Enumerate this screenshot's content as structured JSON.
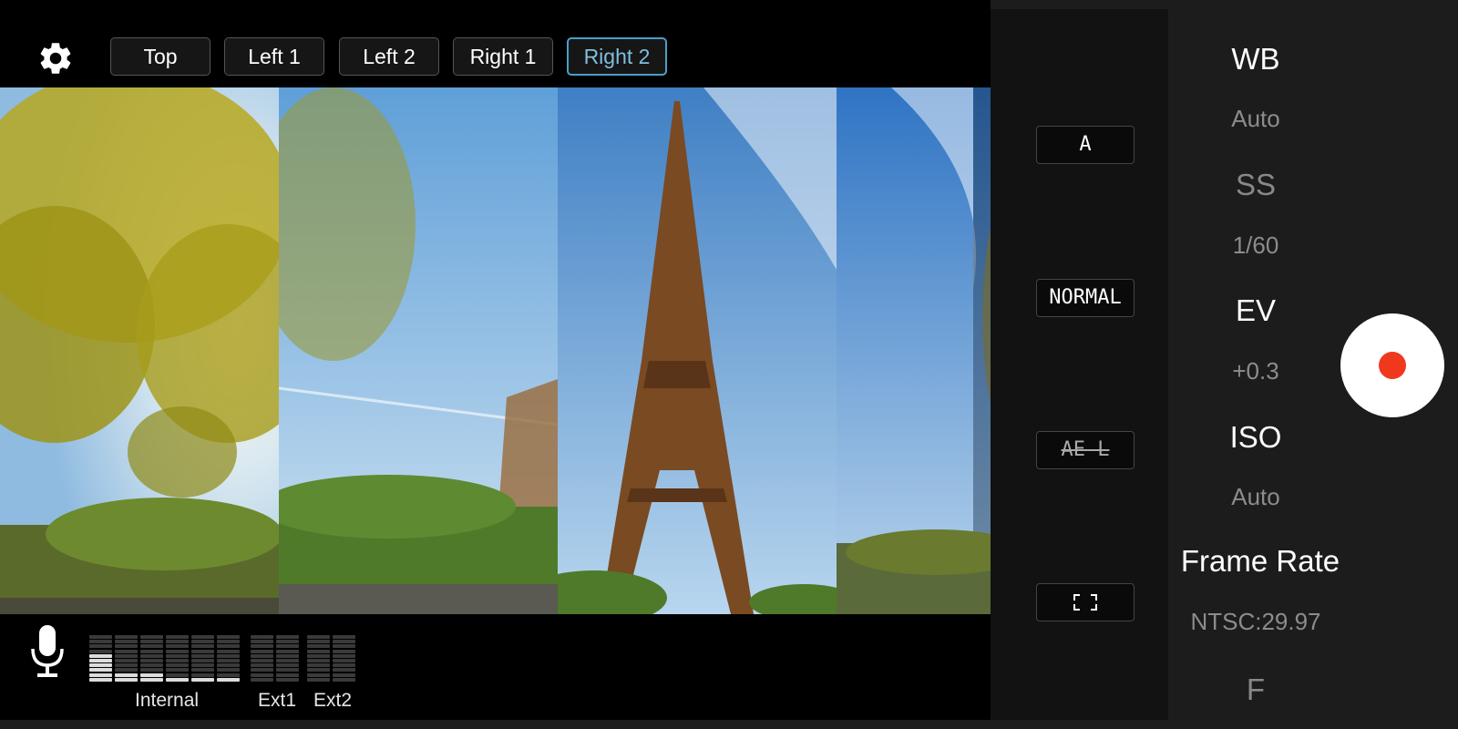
{
  "camera_tabs": [
    "Top",
    "Left 1",
    "Left 2",
    "Right 1",
    "Right 2"
  ],
  "selected_tab": "Right 2",
  "side_buttons": {
    "auto": "A",
    "mode": "NORMAL",
    "ae_lock": "AE-L"
  },
  "audio": {
    "labels": {
      "internal": "Internal",
      "ext1": "Ext1",
      "ext2": "Ext2"
    },
    "levels": [
      6,
      2,
      2,
      1,
      1,
      1,
      0,
      0,
      0,
      0
    ],
    "segments_per_channel": 10
  },
  "settings": {
    "wb_label": "WB",
    "wb_value": "Auto",
    "ss_label": "SS",
    "ss_value": "1/60",
    "ev_label": "EV",
    "ev_value": "+0.3",
    "iso_label": "ISO",
    "iso_value": "Auto",
    "framerate_label": "Frame Rate",
    "framerate_value": "NTSC:29.97",
    "f_label": "F"
  },
  "colors": {
    "accent": "#4a9fc6",
    "record": "#f0391c"
  },
  "icons": {
    "settings": "gear-icon",
    "mic": "microphone-icon",
    "frame": "frame-corners-icon",
    "record": "record-icon"
  }
}
